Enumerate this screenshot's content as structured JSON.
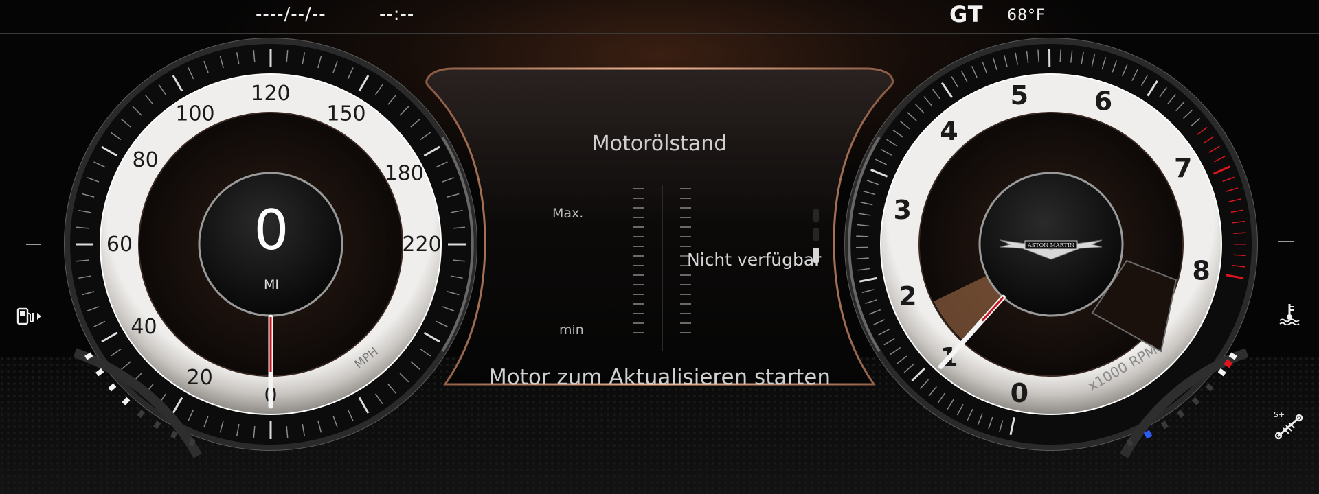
{
  "topbar": {
    "date": "----/--/--",
    "time": "--:--",
    "mode": "GT",
    "temperature": "68°F"
  },
  "speedometer": {
    "labels": [
      "0",
      "20",
      "40",
      "60",
      "80",
      "100",
      "120",
      "150",
      "180",
      "220"
    ],
    "unit": "MPH",
    "speed_value": 0,
    "odometer_value": "0",
    "odometer_unit": "MI"
  },
  "tachometer": {
    "labels": [
      "0",
      "1",
      "2",
      "3",
      "4",
      "5",
      "6",
      "7",
      "8"
    ],
    "unit": "x1000 RPM",
    "rpm_value": 1,
    "brand": "ASTON MARTIN"
  },
  "oil_panel": {
    "title": "Motorölstand",
    "max_label": "Max.",
    "min_label": "min",
    "status": "Nicht verfügbar",
    "hint": "Motor zum Aktualisieren starten"
  },
  "fuel_gauge": {
    "level": 0.45
  },
  "coolant_gauge": {
    "level": 0.3
  },
  "icons": {
    "fuel": "fuel-pump-icon",
    "coolant": "coolant-temperature-icon",
    "suspension": "suspension-mode-icon"
  },
  "colors": {
    "accent": "#d8875a",
    "redline": "#e0141c",
    "cold": "#2a5cf0",
    "needle": "#c8141c"
  }
}
